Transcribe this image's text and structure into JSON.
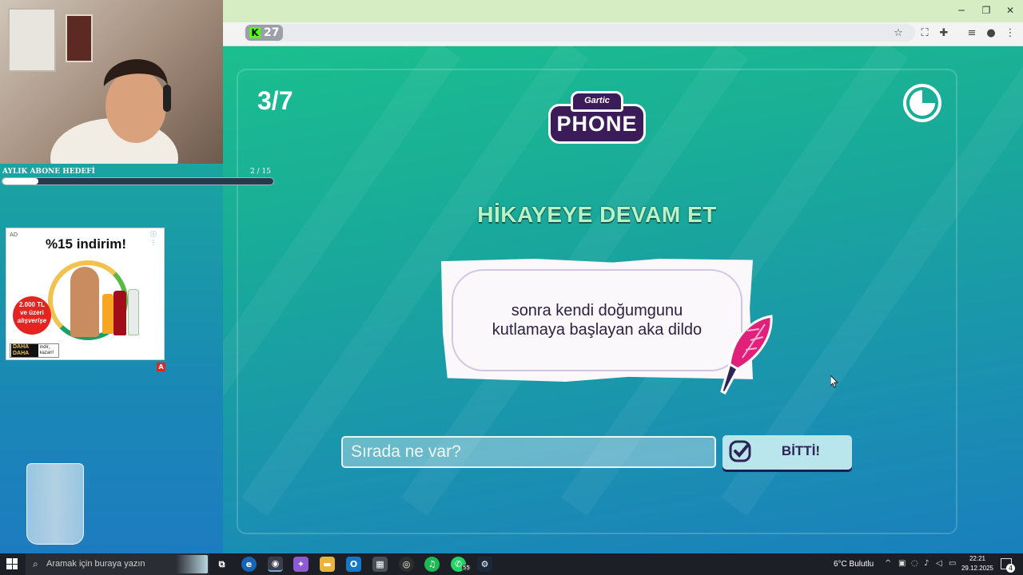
{
  "browser": {
    "kick_badge": "27",
    "window_controls": [
      "─",
      "❐",
      "✕"
    ],
    "toolbar_icons": [
      "star-icon",
      "screenshot-icon",
      "extensions-icon",
      "media-queue-icon",
      "profile-icon",
      "menu-icon"
    ]
  },
  "game": {
    "round": "3/7",
    "logo_small": "Gartic",
    "logo_big": "PHONE",
    "prompt_title": "HİKAYEYE DEVAM ET",
    "story_line1": "sonra kendi doğumgunu",
    "story_line2": "kutlamaya başlayan aka dildo",
    "input_placeholder": "Sırada ne var?",
    "input_value": "",
    "done_label": "BİTTİ!"
  },
  "overlay": {
    "sub_goal_label": "AYLIK ABONE HEDEFİ",
    "sub_goal_count": "2 / 15",
    "sub_goal_progress": 0.133
  },
  "ad": {
    "tag": "AD",
    "headline": "%15 indirim!",
    "badge_line1": "2.000 TL",
    "badge_line2": "ve üzeri",
    "badge_line3": "alışverişe",
    "brand": "DAHA DAHA",
    "cta": "indir, kazan!",
    "adchoice": "A"
  },
  "taskbar": {
    "search_placeholder": "Aramak için buraya yazın",
    "whatsapp_badge": "55",
    "weather": "6°C  Bulutlu",
    "time": "22:21",
    "date": "29.12.2025",
    "notification_count": "4"
  },
  "colors": {
    "accent_green": "#1bbf8e",
    "accent_blue": "#1a7fbd",
    "title_green": "#b8f3c6",
    "button_bg": "#b9e6ec",
    "logo_purple": "#3b1c59"
  }
}
